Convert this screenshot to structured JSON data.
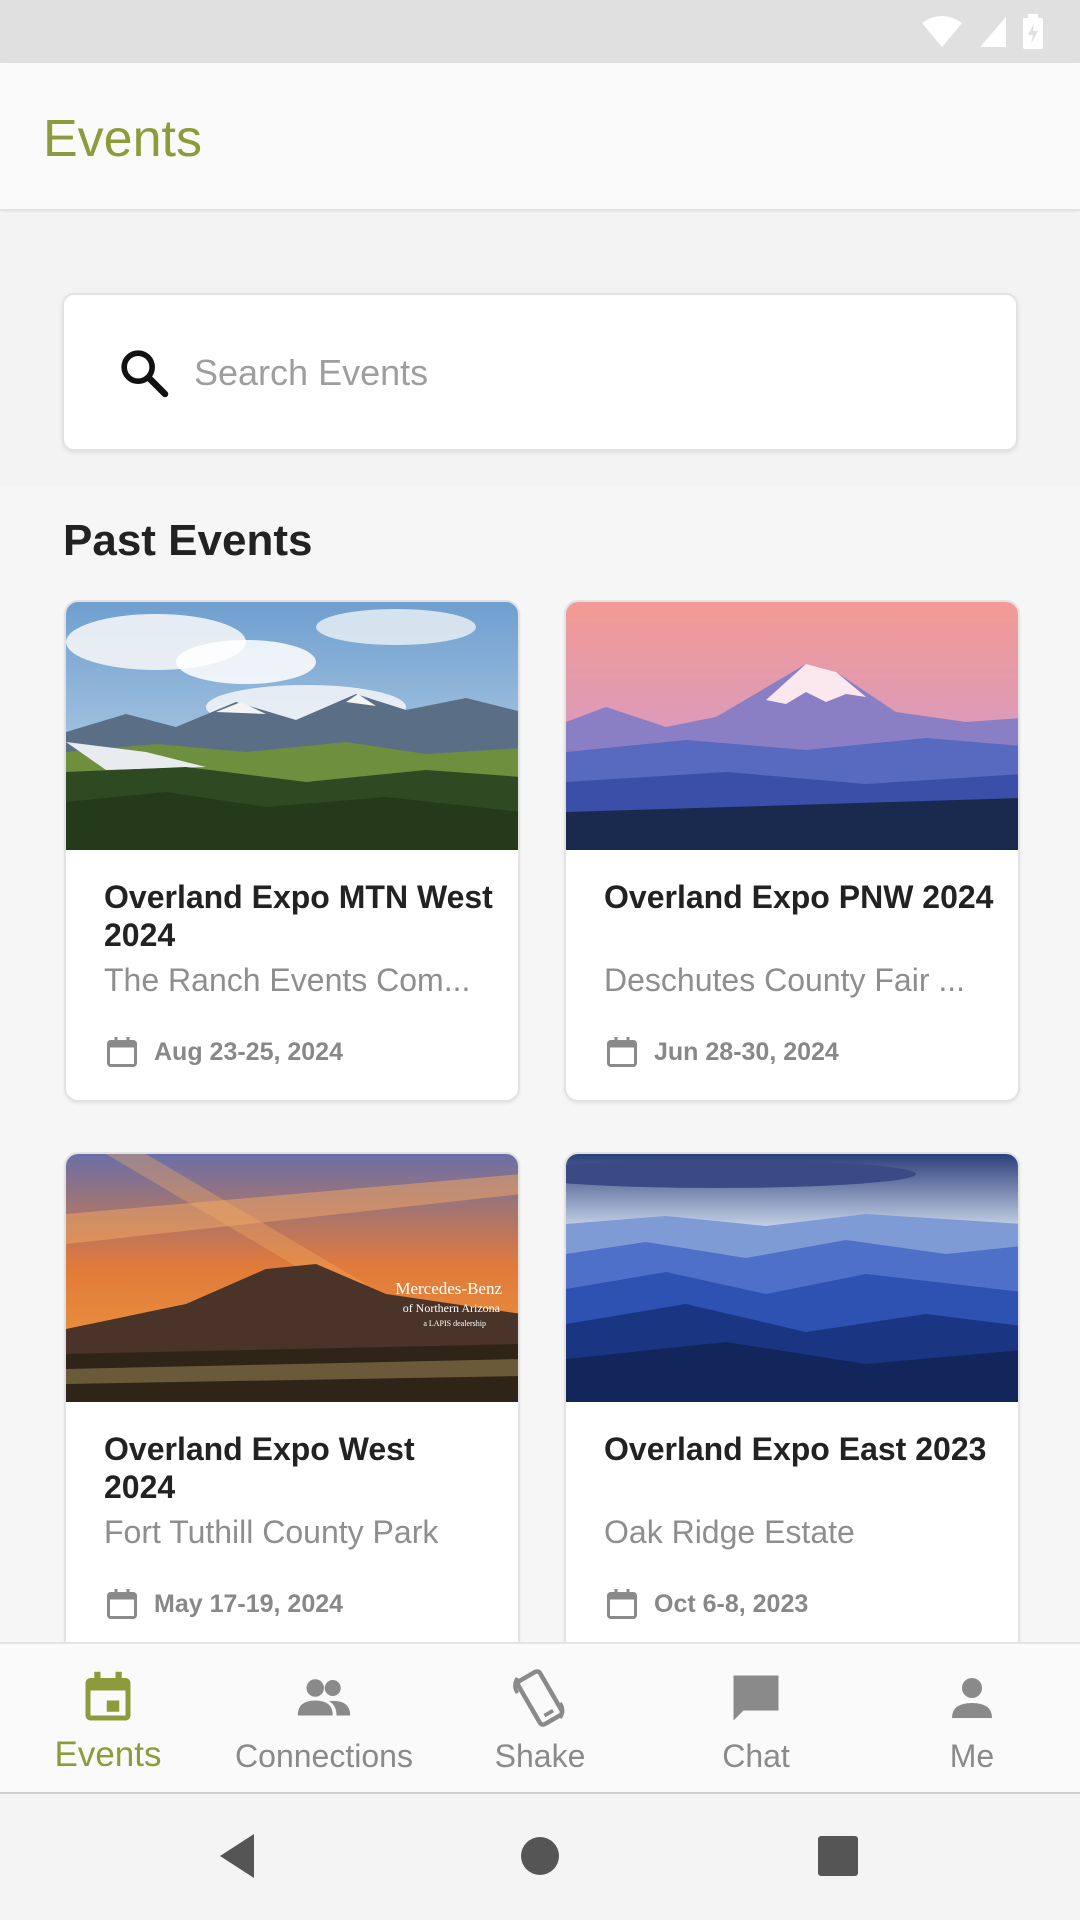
{
  "app": {
    "title": "Events"
  },
  "search": {
    "placeholder": "Search Events",
    "value": ""
  },
  "section": {
    "title": "Past Events"
  },
  "events": [
    {
      "title": "Overland Expo MTN West 2024",
      "location": "The Ranch Events Com...",
      "date": "Aug 23-25, 2024",
      "image": "mountain-meadow-photo"
    },
    {
      "title": "Overland Expo PNW 2024",
      "location": "Deschutes County Fair ...",
      "date": "Jun 28-30, 2024",
      "image": "snow-peak-sunset-photo"
    },
    {
      "title": "Overland Expo West 2024",
      "location": "Fort Tuthill County Park",
      "date": "May 17-19, 2024",
      "image": "orange-sunset-mountain-photo",
      "image_text": {
        "line1": "Mercedes-Benz",
        "line2": "of Northern Arizona",
        "line3": "a LAPIS dealership"
      }
    },
    {
      "title": "Overland Expo East 2023",
      "location": "Oak Ridge Estate",
      "date": "Oct 6-8, 2023",
      "image": "blue-ridge-mountains-photo"
    }
  ],
  "nav": {
    "items": [
      {
        "label": "Events",
        "icon": "calendar-icon",
        "active": true
      },
      {
        "label": "Connections",
        "icon": "people-icon",
        "active": false
      },
      {
        "label": "Shake",
        "icon": "shake-phone-icon",
        "active": false
      },
      {
        "label": "Chat",
        "icon": "chat-icon",
        "active": false
      },
      {
        "label": "Me",
        "icon": "person-icon",
        "active": false
      }
    ]
  },
  "colors": {
    "accent": "#8d9b3a",
    "inactive": "#8a8a8a"
  }
}
